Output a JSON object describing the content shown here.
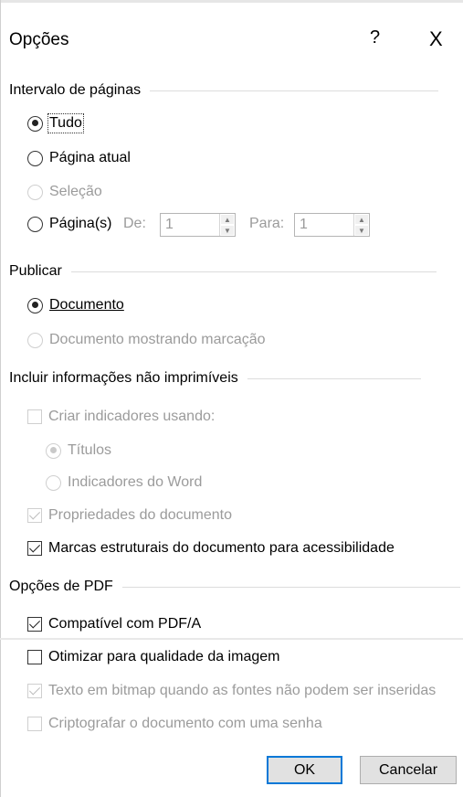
{
  "dialog": {
    "title": "Opções",
    "help_label": "?",
    "close_label": "X"
  },
  "page_range": {
    "group_label": "Intervalo de páginas",
    "all_label": "Tudo",
    "current_label": "Página atual",
    "selection_label": "Seleção",
    "pages_label": "Página(s)",
    "from_label": "De:",
    "from_value": "1",
    "to_label": "Para:",
    "to_value": "1"
  },
  "publish": {
    "group_label": "Publicar",
    "document_label": "Documento",
    "markup_label": "Documento mostrando marcação"
  },
  "nonprint": {
    "group_label": "Incluir informações não imprimíveis",
    "bookmarks_label": "Criar indicadores usando:",
    "headings_label": "Títulos",
    "word_bookmarks_label": "Indicadores do Word",
    "properties_label": "Propriedades do documento",
    "tags_label": "Marcas estruturais do documento para acessibilidade"
  },
  "pdf": {
    "group_label": "Opções de PDF",
    "pdfa_label": "Compatível com PDF/A",
    "optimize_label": "Otimizar para qualidade da imagem",
    "bitmap_label": "Texto em bitmap quando as fontes não podem ser inseridas",
    "encrypt_label": "Criptografar o documento com uma senha"
  },
  "buttons": {
    "ok": "OK",
    "cancel": "Cancelar"
  }
}
